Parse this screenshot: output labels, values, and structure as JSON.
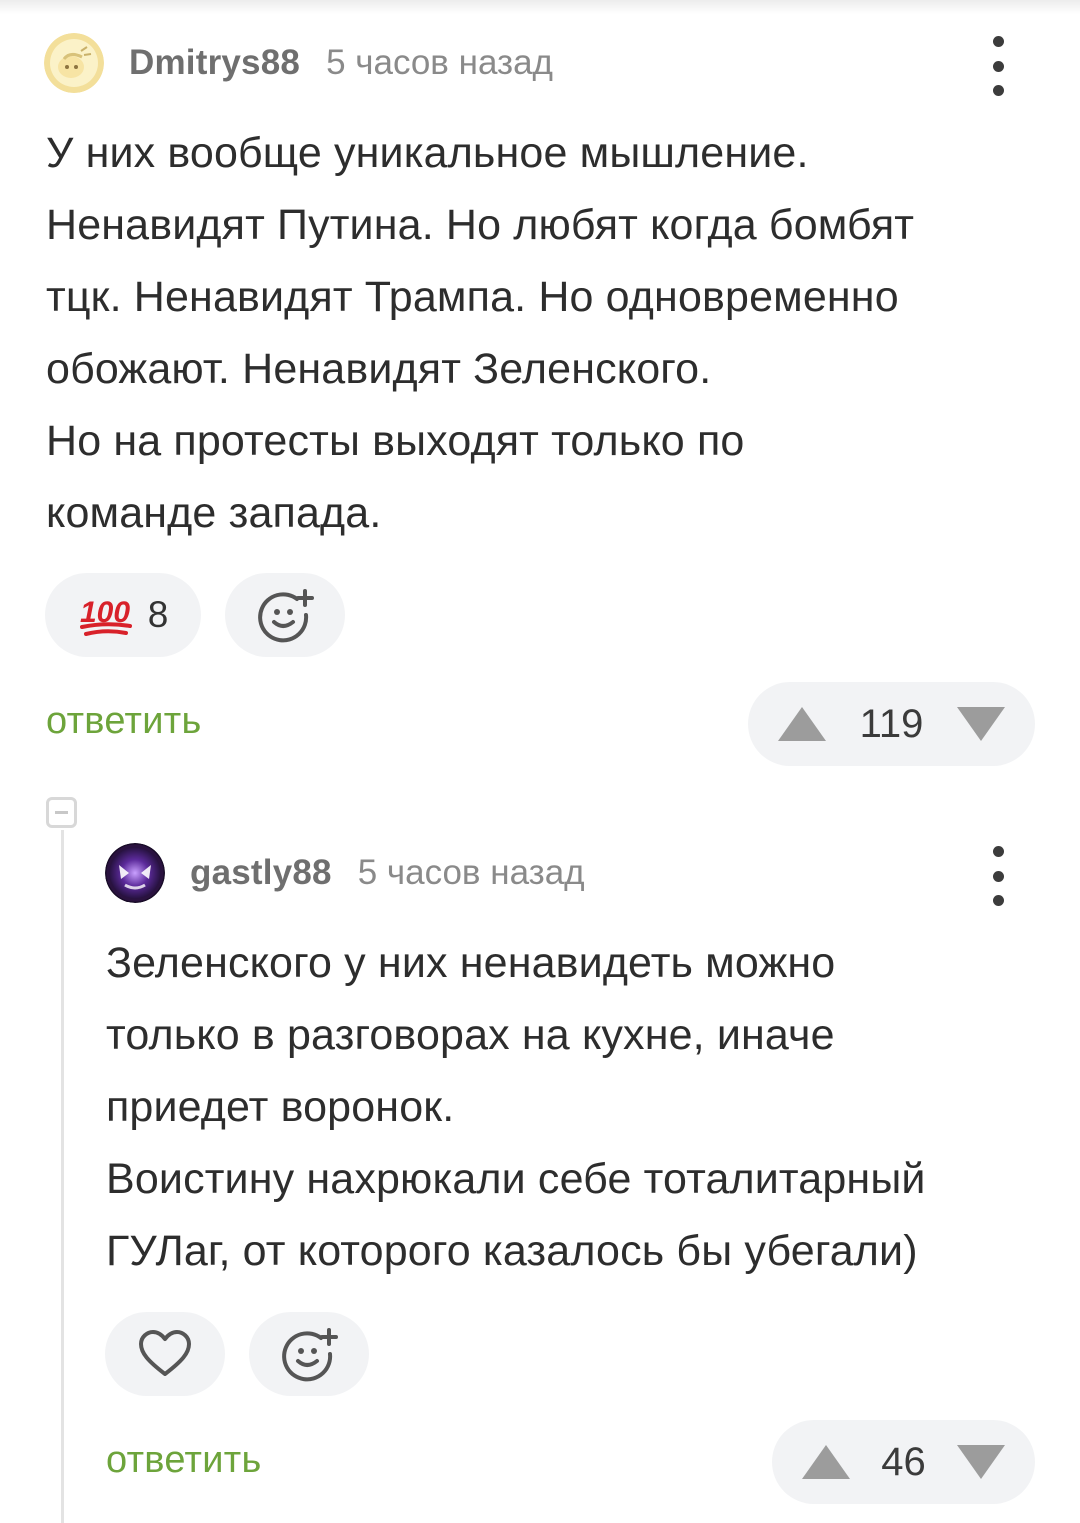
{
  "comments": [
    {
      "username": "Dmitrys88",
      "time": "5 часов назад",
      "text": "У них вообще уникальное мышление.\nНенавидят Путина. Но любят когда бомбят\nтцк. Ненавидят Трампа. Но одновременно\nобожают. Ненавидят Зеленского.\nНо на протесты выходят только по\nкоманде запада.",
      "reaction_icon": "100-emoji-icon",
      "reaction_count": "8",
      "reply_label": "ответить",
      "score": "119"
    },
    {
      "username": "gastly88",
      "time": "5 часов назад",
      "text": "Зеленского у них ненавидеть можно\nтолько в разговорах на кухне, иначе\nприедет воронок.\nВоистину нахрюкали себе тоталитарный\nГУЛаг, от которого казалось бы убегали)",
      "reaction_icon": "heart-icon",
      "reply_label": "ответить",
      "score": "46"
    }
  ],
  "colors": {
    "reply": "#6da43b",
    "pill_bg": "#f2f3f5",
    "hundred_red": "#d8212a"
  }
}
